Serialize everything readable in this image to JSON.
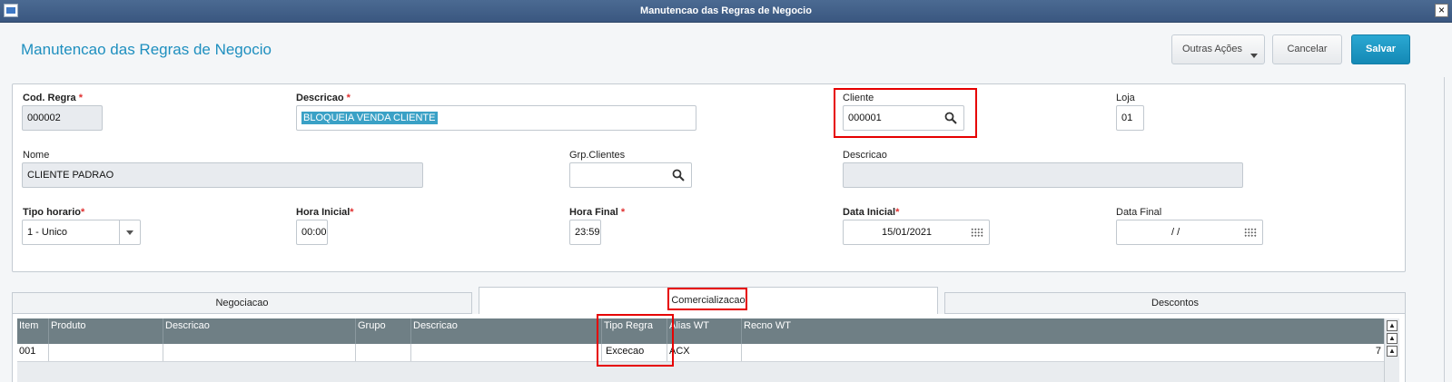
{
  "window": {
    "title": "Manutencao das Regras de Negocio",
    "close_glyph": "×"
  },
  "header": {
    "title": "Manutencao das Regras de Negocio",
    "buttons": {
      "outras": "Outras Ações",
      "cancelar": "Cancelar",
      "salvar": "Salvar"
    }
  },
  "form": {
    "cod_regra": {
      "label": "Cod. Regra",
      "required": "*",
      "value": "000002"
    },
    "descricao": {
      "label": "Descricao",
      "required": "*",
      "value": "BLOQUEIA VENDA CLIENTE"
    },
    "cliente": {
      "label": "Cliente",
      "value": "000001"
    },
    "loja": {
      "label": "Loja",
      "value": "01"
    },
    "nome": {
      "label": "Nome",
      "value": "CLIENTE PADRAO"
    },
    "grp_clientes": {
      "label": "Grp.Clientes",
      "value": ""
    },
    "descricao2": {
      "label": "Descricao",
      "value": ""
    },
    "tipo_horario": {
      "label": "Tipo horario",
      "required": "*",
      "value": "1 - Unico"
    },
    "hora_inicial": {
      "label": "Hora Inicial",
      "required": "*",
      "value": "00:00"
    },
    "hora_final": {
      "label": "Hora Final",
      "required": "*",
      "value": "23:59"
    },
    "data_inicial": {
      "label": "Data Inicial",
      "required": "*",
      "value": "15/01/2021"
    },
    "data_final": {
      "label": "Data Final",
      "value": "/ /"
    }
  },
  "tabs": [
    {
      "label": "Negociacao"
    },
    {
      "label": "Comercializacao",
      "active": true
    },
    {
      "label": "Descontos"
    }
  ],
  "grid": {
    "columns": [
      "Item",
      "Produto",
      "Descricao",
      "Grupo",
      "Descricao",
      "Tipo Regra",
      "Alias WT",
      "Recno WT"
    ],
    "rows": [
      {
        "item": "001",
        "produto": "",
        "descricao": "",
        "grupo": "",
        "descricao2": "",
        "tipo_regra": "Excecao",
        "alias_wt": "ACX",
        "recno_wt": "7"
      }
    ]
  },
  "colors": {
    "accent": "#1e8fbf",
    "save": "#1c9ac6",
    "highlight": "#e60000",
    "grid_header": "#6f7f85"
  }
}
